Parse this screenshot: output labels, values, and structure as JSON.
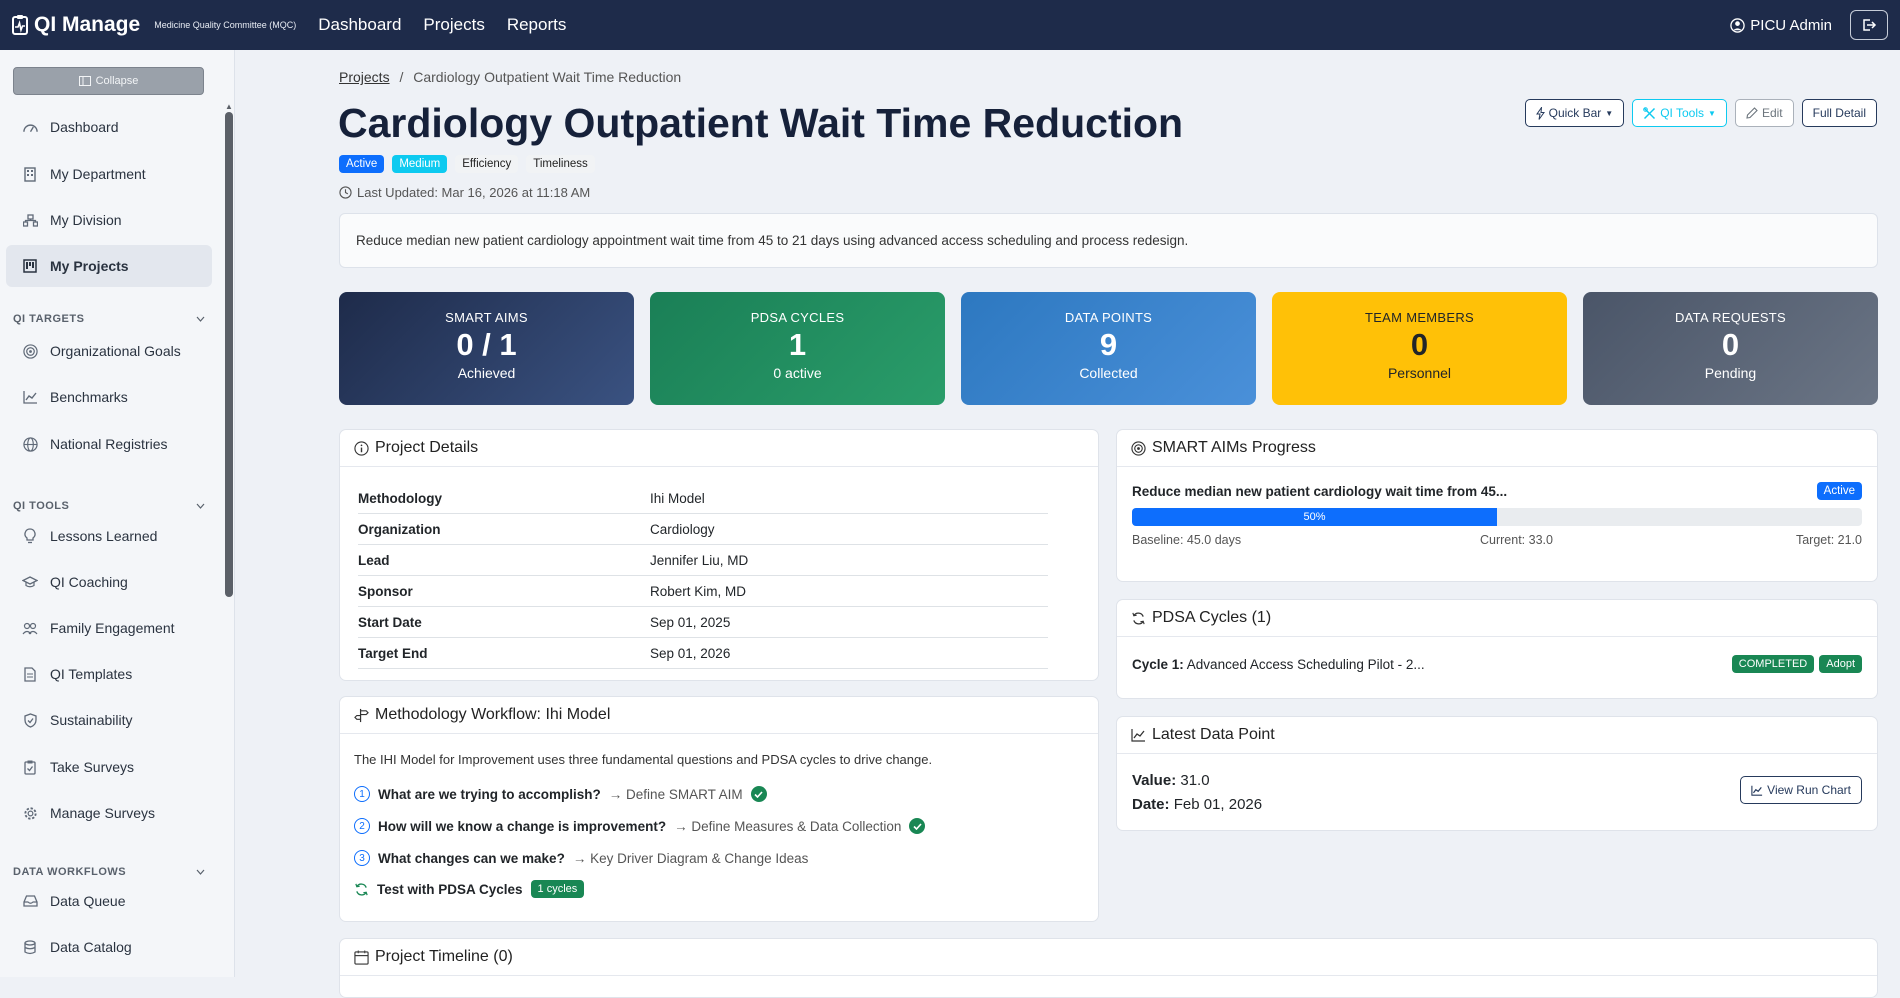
{
  "app": {
    "name": "QI Manage",
    "subtitle": "Medicine Quality Committee (MQC)"
  },
  "nav": {
    "links": [
      "Dashboard",
      "Projects",
      "Reports"
    ],
    "user": "PICU Admin"
  },
  "sidebar": {
    "collapse_label": "Collapse",
    "items": [
      {
        "label": "Dashboard",
        "icon": "gauge-icon"
      },
      {
        "label": "My Department",
        "icon": "building-icon"
      },
      {
        "label": "My Division",
        "icon": "org-chart-icon"
      },
      {
        "label": "My Projects",
        "icon": "kanban-icon"
      }
    ],
    "sections": [
      {
        "title": "QI TARGETS",
        "items": [
          {
            "label": "Organizational Goals",
            "icon": "bullseye-icon"
          },
          {
            "label": "Benchmarks",
            "icon": "graph-up-icon"
          },
          {
            "label": "National Registries",
            "icon": "globe-icon"
          }
        ]
      },
      {
        "title": "QI TOOLS",
        "items": [
          {
            "label": "Lessons Learned",
            "icon": "lightbulb-icon"
          },
          {
            "label": "QI Coaching",
            "icon": "mortarboard-icon"
          },
          {
            "label": "Family Engagement",
            "icon": "people-icon"
          },
          {
            "label": "QI Templates",
            "icon": "file-text-icon"
          },
          {
            "label": "Sustainability",
            "icon": "shield-check-icon"
          },
          {
            "label": "Take Surveys",
            "icon": "clipboard-check-icon"
          },
          {
            "label": "Manage Surveys",
            "icon": "gear-icon"
          }
        ]
      },
      {
        "title": "DATA WORKFLOWS",
        "items": [
          {
            "label": "Data Queue",
            "icon": "inbox-icon"
          },
          {
            "label": "Data Catalog",
            "icon": "database-icon"
          }
        ]
      }
    ]
  },
  "breadcrumb": {
    "parent": "Projects",
    "separator": "/",
    "current": "Cardiology Outpatient Wait Time Reduction"
  },
  "project": {
    "title": "Cardiology Outpatient Wait Time Reduction",
    "badges": [
      "Active",
      "Medium",
      "Efficiency",
      "Timeliness"
    ],
    "last_updated": "Last Updated: Mar 16, 2026 at 11:18 AM",
    "description": "Reduce median new patient cardiology appointment wait time from 45 to 21 days using advanced access scheduling and process redesign."
  },
  "actions": {
    "quick_bar": "Quick Bar",
    "qi_tools": "QI Tools",
    "edit": "Edit",
    "full_detail": "Full Detail"
  },
  "stats": [
    {
      "label": "SMART AIMS",
      "value": "0 / 1",
      "sub": "Achieved",
      "color_from": "#1e2b4a",
      "color_to": "#3a5281"
    },
    {
      "label": "PDSA CYCLES",
      "value": "1",
      "sub": "0 active",
      "color_from": "#1a7f56",
      "color_to": "#2a9d6a"
    },
    {
      "label": "DATA POINTS",
      "value": "9",
      "sub": "Collected",
      "color_from": "#2d78c0",
      "color_to": "#4a90d9"
    },
    {
      "label": "TEAM MEMBERS",
      "value": "0",
      "sub": "Personnel",
      "color_from": "#ffc107",
      "color_to": "#ffc107"
    },
    {
      "label": "DATA REQUESTS",
      "value": "0",
      "sub": "Pending",
      "color_from": "#4a5568",
      "color_to": "#6b7585"
    }
  ],
  "details": {
    "title": "Project Details",
    "rows": [
      {
        "k": "Methodology",
        "v": "Ihi Model"
      },
      {
        "k": "Organization",
        "v": "Cardiology"
      },
      {
        "k": "Lead",
        "v": "Jennifer Liu, MD"
      },
      {
        "k": "Sponsor",
        "v": "Robert Kim, MD"
      },
      {
        "k": "Start Date",
        "v": "Sep 01, 2025"
      },
      {
        "k": "Target End",
        "v": "Sep 01, 2026"
      }
    ]
  },
  "workflow": {
    "title": "Methodology Workflow: Ihi Model",
    "intro": "The IHI Model for Improvement uses three fundamental questions and PDSA cycles to drive change.",
    "steps": [
      {
        "n": "1",
        "q": "What are we trying to accomplish?",
        "a": "→ Define SMART AIM",
        "done": true
      },
      {
        "n": "2",
        "q": "How will we know a change is improvement?",
        "a": "→ Define Measures & Data Collection",
        "done": true
      },
      {
        "n": "3",
        "q": "What changes can we make?",
        "a": "→ Key Driver Diagram & Change Ideas",
        "done": false
      }
    ],
    "pdsa_label": "Test with PDSA Cycles",
    "pdsa_badge": "1 cycles"
  },
  "smart_aims": {
    "title": "SMART AIMs Progress",
    "aim": "Reduce median new patient cardiology wait time from 45...",
    "status": "Active",
    "progress": 50,
    "progress_label": "50%",
    "baseline": "Baseline: 45.0 days",
    "current": "Current: 33.0",
    "target": "Target: 21.0"
  },
  "pdsa": {
    "title": "PDSA Cycles (1)",
    "cycle_label": "Cycle 1:",
    "cycle_name": "Advanced Access Scheduling Pilot - 2...",
    "status": "COMPLETED",
    "decision": "Adopt"
  },
  "latest": {
    "title": "Latest Data Point",
    "value_label": "Value:",
    "value": "31.0",
    "date_label": "Date:",
    "date": "Feb 01, 2026",
    "button": "View Run Chart"
  },
  "timeline": {
    "title": "Project Timeline (0)"
  }
}
